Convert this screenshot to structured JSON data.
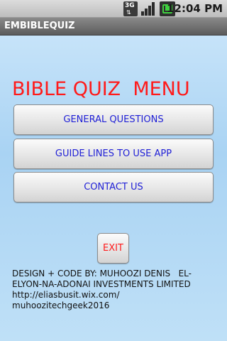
{
  "status_bar": {
    "network_label": "3G",
    "time": "12:04 PM",
    "icons": [
      "3g-icon",
      "signal-icon",
      "battery-icon"
    ]
  },
  "app": {
    "title": "EMBIBLEQUIZ"
  },
  "menu": {
    "heading": "BIBLE QUIZ  MENU",
    "buttons": [
      {
        "label": "GENERAL QUESTIONS"
      },
      {
        "label": "GUIDE LINES TO USE APP"
      },
      {
        "label": "CONTACT US"
      }
    ],
    "exit_label": "EXIT"
  },
  "credits": {
    "line1": "DESIGN + CODE BY: MUHOOZI DENIS   EL-",
    "line2": "ELYON-NA-ADONAI INVESTMENTS LIMITED",
    "line3": "http://eliasbusit.wix.com/",
    "line4": "muhoozitechgeek2016"
  },
  "colors": {
    "heading": "#ff1a1a",
    "button_text": "#1f1fd6",
    "exit_text": "#ff1a1a",
    "background": "#a9d3f3"
  }
}
